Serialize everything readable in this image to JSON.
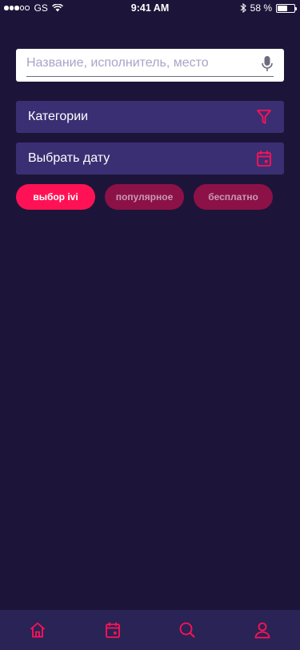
{
  "status_bar": {
    "carrier": "GS",
    "time": "9:41 AM",
    "battery_text": "58 %",
    "battery_level": 0.58
  },
  "search": {
    "placeholder": "Название, исполнитель, место",
    "value": "",
    "icon": "mic-icon"
  },
  "filters": {
    "categories_label": "Категории",
    "categories_icon": "filter-icon",
    "date_label": "Выбрать дату",
    "date_icon": "calendar-icon"
  },
  "chips": [
    {
      "label": "выбор ivi",
      "active": true
    },
    {
      "label": "популярное",
      "active": false
    },
    {
      "label": "бесплатно",
      "active": false
    }
  ],
  "bottom_nav": {
    "items": [
      {
        "name": "home",
        "icon": "home-icon"
      },
      {
        "name": "calendar",
        "icon": "calendar-icon"
      },
      {
        "name": "search",
        "icon": "search-icon"
      },
      {
        "name": "profile",
        "icon": "profile-icon"
      }
    ]
  },
  "colors": {
    "background": "#1d1539",
    "accent": "#ff1255",
    "panel": "#3b2f73",
    "chip_inactive": "#8c1147",
    "nav_bg": "#2a2356"
  }
}
